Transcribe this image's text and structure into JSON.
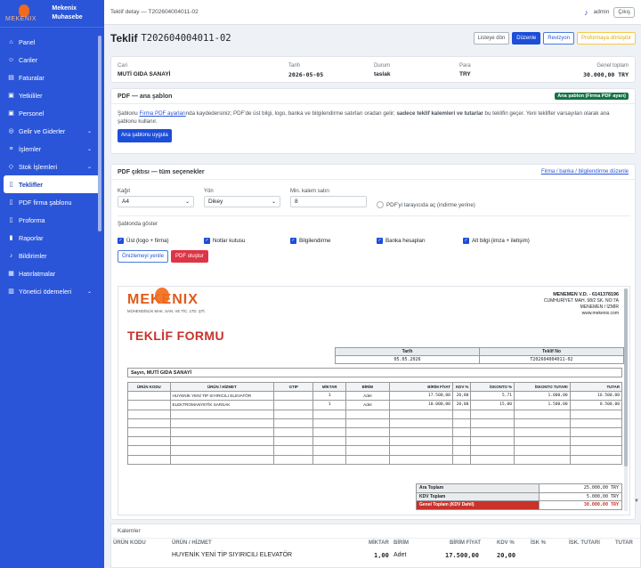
{
  "brand": {
    "logo_text": "MEKENIX",
    "name": "Mekenix Muhasebe"
  },
  "sidebar": {
    "items": [
      {
        "label": "Panel",
        "icon": "dashboard-icon",
        "glyph": "⌂",
        "chev": ""
      },
      {
        "label": "Cariler",
        "icon": "users-icon",
        "glyph": "☺",
        "chev": ""
      },
      {
        "label": "Faturalar",
        "icon": "invoice-icon",
        "glyph": "▤",
        "chev": ""
      },
      {
        "label": "Yetkililer",
        "icon": "person-badge-icon",
        "glyph": "▣",
        "chev": ""
      },
      {
        "label": "Personel",
        "icon": "id-card-icon",
        "glyph": "▣",
        "chev": ""
      },
      {
        "label": "Gelir ve Giderler",
        "icon": "coins-icon",
        "glyph": "◎",
        "chev": "⌄"
      },
      {
        "label": "İşlemler",
        "icon": "list-icon",
        "glyph": "≡",
        "chev": "⌄"
      },
      {
        "label": "Stok İşlemleri",
        "icon": "box-icon",
        "glyph": "◇",
        "chev": "⌄"
      },
      {
        "label": "Teklifler",
        "icon": "document-icon",
        "glyph": "▯",
        "chev": ""
      },
      {
        "label": "PDF firma şablonu",
        "icon": "file-pdf-icon",
        "glyph": "▯",
        "chev": ""
      },
      {
        "label": "Proforma",
        "icon": "receipt-icon",
        "glyph": "▯",
        "chev": ""
      },
      {
        "label": "Raporlar",
        "icon": "bar-chart-icon",
        "glyph": "▮",
        "chev": ""
      },
      {
        "label": "Bildirimler",
        "icon": "bell-icon",
        "glyph": "♪",
        "chev": ""
      },
      {
        "label": "Hatırlatmalar",
        "icon": "calendar-icon",
        "glyph": "▦",
        "chev": ""
      },
      {
        "label": "Yönetici ödemeleri",
        "icon": "bank-icon",
        "glyph": "▥",
        "chev": "⌄"
      }
    ],
    "active_index": 8
  },
  "topbar": {
    "breadcrumb": "Teklif detay — T202604004011-02",
    "user": "admin",
    "logout": "Çıkış"
  },
  "page": {
    "title": "Teklif",
    "code": "T202604004011-02",
    "buttons": {
      "back": "Listeye dön",
      "edit": "Düzenle",
      "revision": "Revizyon",
      "proforma": "Proformaya dönüştür"
    }
  },
  "info": {
    "cari_label": "Cari",
    "cari": "MUTİ GIDA SANAYİ",
    "tarih_label": "Tarih",
    "tarih": "2026-05-05",
    "durum_label": "Durum",
    "durum": "taslak",
    "para_label": "Para",
    "para": "TRY",
    "genel_label": "Genel toplam",
    "genel": "30.000,00 TRY"
  },
  "pdf_card": {
    "title": "PDF — ana şablon",
    "badge": "Ana şablon (Firma PDF ayarı)",
    "text_pre": "Şablonu ",
    "link": "Firma PDF ayarları",
    "text_mid": "nda kaydedersiniz; PDF'de üst bilgi, logo, banka ve bilgilendirme satırları oradan gelir; ",
    "text_bold": "sadece teklif kalemleri ve tutarlar",
    "text_post": " bu teklifin geçer. Yeni teklifler varsayılan olarak ana şablonu kullanır.",
    "apply_button": "Ana şablonu uygula"
  },
  "options": {
    "title": "PDF çıktısı — tüm seçenekler",
    "header_link": "Firma / banka / bilgilendirme düzenle",
    "paper_label": "Kağıt",
    "paper": "A4",
    "orientation_label": "Yön",
    "orientation": "Dikey",
    "min_rows_label": "Min. kalem satırı",
    "min_rows": "8",
    "radio_label": "PDF'yi tarayıcıda aç (indirme yerine)",
    "section_label": "Şablonda göster",
    "checks": [
      "Üst (logo + firma)",
      "Notlar kutusu",
      "Bilgilendirme",
      "Banka hesapları",
      "Alt bilgi (imza + iletişim)"
    ],
    "refresh_button": "Önizlemeyi yenile",
    "create_button": "PDF oluştur"
  },
  "preview": {
    "logo": "MEKENIX",
    "logo_sub": "MÜHENDİSLİK MAK. SAN. VE TİC. LTD. ŞTİ.",
    "address": [
      "MENEMEN V.D. - 6141378196",
      "CUMHURİYET MAH. 98/2 SK. NO:7A",
      "MENEMEN / İZMİR",
      "www.mekenix.com"
    ],
    "form_title": "TEKLİF FORMU",
    "meta_headers": [
      "Tarih",
      "Teklif No"
    ],
    "meta_values": [
      "05.05.2026",
      "T202604004011-02"
    ],
    "salutation": "Sayın, MUTİ GIDA SANAYİ",
    "col_headers": [
      "ÜRÜN KODU",
      "ÜRÜN / HİZMET",
      "GTIP",
      "MİKTAR",
      "BİRİM",
      "BİRİM FİYAT",
      "KDV %",
      "İSKONTO %",
      "İSKONTO TUTARI",
      "TUTAR"
    ],
    "rows": [
      {
        "kod": "",
        "urun": "HUYENİK YENİ TİP SIYIRICILI ELEVATÖR",
        "gtip": "",
        "miktar": "1",
        "birim": "Adet",
        "fiyat": "17.500,00",
        "kdv": "20,00",
        "isk": "5,71",
        "isk_tut": "1.000,00",
        "tutar": "16.500,00"
      },
      {
        "kod": "",
        "urun": "ELEKTROMANYETİK SARSAK",
        "gtip": "",
        "miktar": "1",
        "birim": "Adet",
        "fiyat": "10.000,00",
        "kdv": "20,00",
        "isk": "15,00",
        "isk_tut": "1.500,00",
        "tutar": "8.500,00"
      }
    ],
    "totals": [
      {
        "label": "Ara Toplam",
        "value": "25.000,00 TRY"
      },
      {
        "label": "KDV Toplam",
        "value": "5.000,00 TRY"
      },
      {
        "label": "Genel Toplam (KDV Dahil)",
        "value": "30.000,00 TRY"
      }
    ]
  },
  "kalemler": {
    "title": "Kalemler",
    "headers": [
      "ÜRÜN KODU",
      "ÜRÜN / HİZMET",
      "MİKTAR",
      "BİRİM",
      "BİRİM FİYAT",
      "KDV %",
      "İSK %",
      "İSK. TUTARI",
      "TUTAR"
    ],
    "first_row": {
      "urun": "HUYENİK YENİ TİP SIYIRICILI ELEVATÖR",
      "miktar": "1,00",
      "birim": "Adet",
      "fiyat": "17.500,00",
      "kdv": "20,00"
    }
  }
}
